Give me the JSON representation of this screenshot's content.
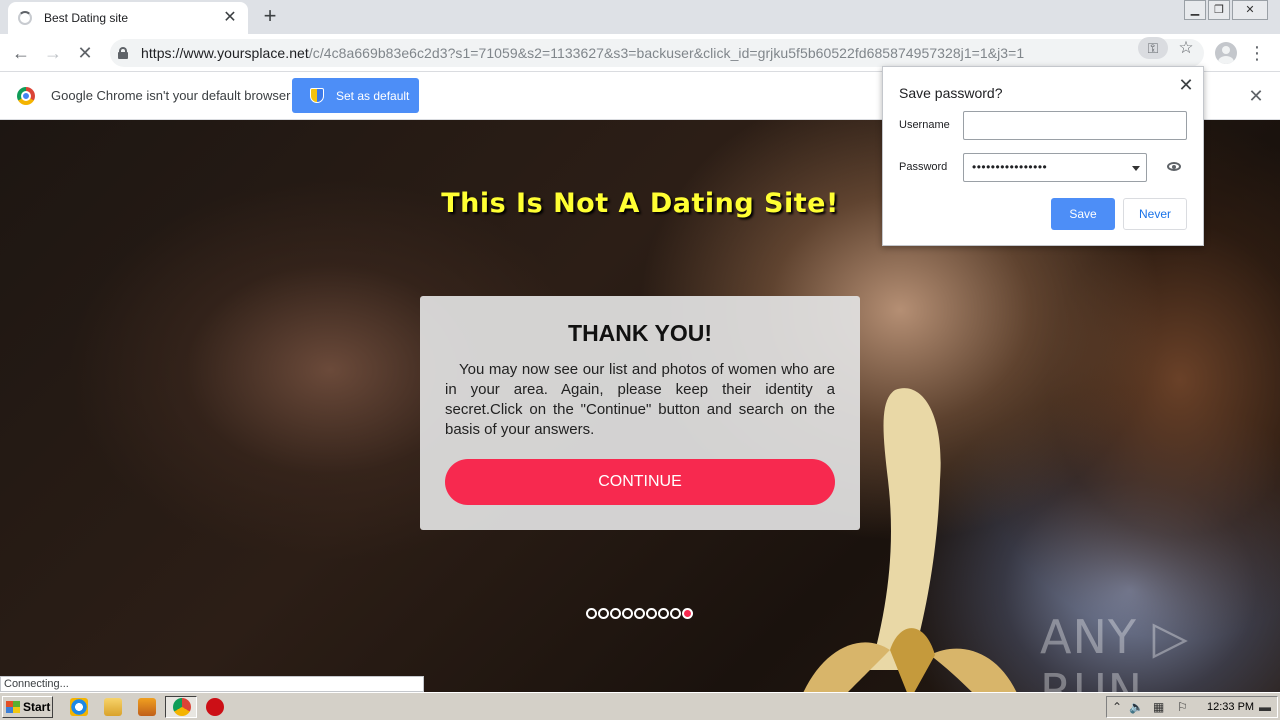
{
  "browser": {
    "tab_title": "Best Dating site",
    "url_host": "https://www.yoursplace.net",
    "url_path": "/c/4c8a669b83e6c2d3?s1=71059&s2=1133627&s3=backuser&click_id=grjku5f5b60522fd685874957328j1=1&j3=1"
  },
  "infobar": {
    "message": "Google Chrome isn't your default browser",
    "button": "Set as default"
  },
  "page": {
    "headline": "This Is Not A Dating Site!",
    "card_title": "THANK YOU!",
    "card_text": "You may now see our list and photos of women who are in your area. Again, please keep their identity a secret.Click on the \"Continue\" button and search on the basis of your answers.",
    "continue_label": "CONTINUE",
    "progress_dots": {
      "total": 9,
      "active_index": 8
    },
    "watermark": "ANY ▷ RUN",
    "status_text": "Connecting..."
  },
  "password_bubble": {
    "title": "Save password?",
    "username_label": "Username",
    "username_value": "",
    "password_label": "Password",
    "password_value": "••••••••••••••••",
    "save_label": "Save",
    "never_label": "Never"
  },
  "taskbar": {
    "start_label": "Start",
    "clock": "12:33 PM"
  },
  "colors": {
    "accent_red": "#f7294f",
    "headline_yellow": "#ffff33",
    "chrome_blue": "#4d8ef7"
  }
}
